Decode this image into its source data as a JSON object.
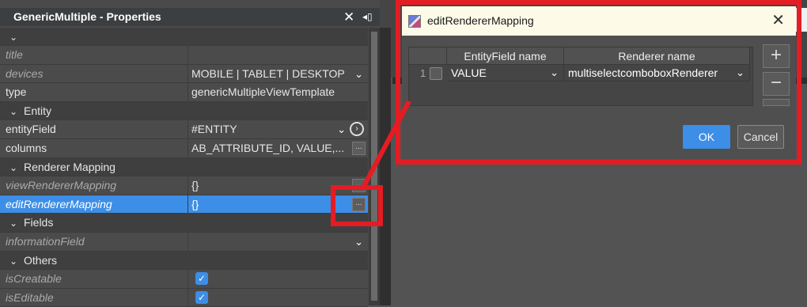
{
  "panel": {
    "title": "GenericMultiple - Properties",
    "close_glyph": "✕",
    "pin_glyph": "◂▯"
  },
  "properties": [
    {
      "kind": "prop",
      "name": "title",
      "value": "",
      "italic": true
    },
    {
      "kind": "prop",
      "name": "devices",
      "value": "MOBILE | TABLET | DESKTOP",
      "italic": true,
      "control": "dropdown"
    },
    {
      "kind": "prop",
      "name": "type",
      "value": "genericMultipleViewTemplate",
      "italic": false
    },
    {
      "kind": "section",
      "name": "Entity"
    },
    {
      "kind": "prop",
      "name": "entityField",
      "value": "#ENTITY",
      "italic": false,
      "control": "dropdown-nav"
    },
    {
      "kind": "prop",
      "name": "columns",
      "value": "AB_ATTRIBUTE_ID, VALUE,...",
      "italic": false,
      "control": "ellipsis"
    },
    {
      "kind": "section",
      "name": "Renderer Mapping"
    },
    {
      "kind": "prop",
      "name": "viewRendererMapping",
      "value": "{}",
      "italic": true,
      "control": "ellipsis"
    },
    {
      "kind": "prop",
      "name": "editRendererMapping",
      "value": "{}",
      "italic": true,
      "selected": true,
      "control": "ellipsis"
    },
    {
      "kind": "section",
      "name": "Fields"
    },
    {
      "kind": "prop",
      "name": "informationField",
      "value": "",
      "italic": true,
      "control": "dropdown"
    },
    {
      "kind": "section",
      "name": "Others"
    },
    {
      "kind": "prop",
      "name": "isCreatable",
      "value": "",
      "italic": true,
      "control": "checkbox",
      "checked": true
    },
    {
      "kind": "prop",
      "name": "isEditable",
      "value": "",
      "italic": true,
      "control": "checkbox",
      "checked": true
    }
  ],
  "dialog": {
    "title": "editRendererMapping",
    "close_glyph": "✕",
    "columns": [
      "EntityField name",
      "Renderer name"
    ],
    "rows": [
      {
        "index": "1",
        "entity_field": "VALUE",
        "renderer": "multiselectcomboboxRenderer"
      }
    ],
    "add_glyph": "+",
    "remove_glyph": "−",
    "ok_label": "OK",
    "cancel_label": "Cancel"
  },
  "glyphs": {
    "chevron_down": "⌄",
    "ellipsis": "...",
    "check": "✓",
    "nav_arrow": "›"
  },
  "colors": {
    "selection": "#3d8ee6",
    "annotation_red": "#e51c23",
    "dialog_titlebar": "#fdfbe8"
  }
}
